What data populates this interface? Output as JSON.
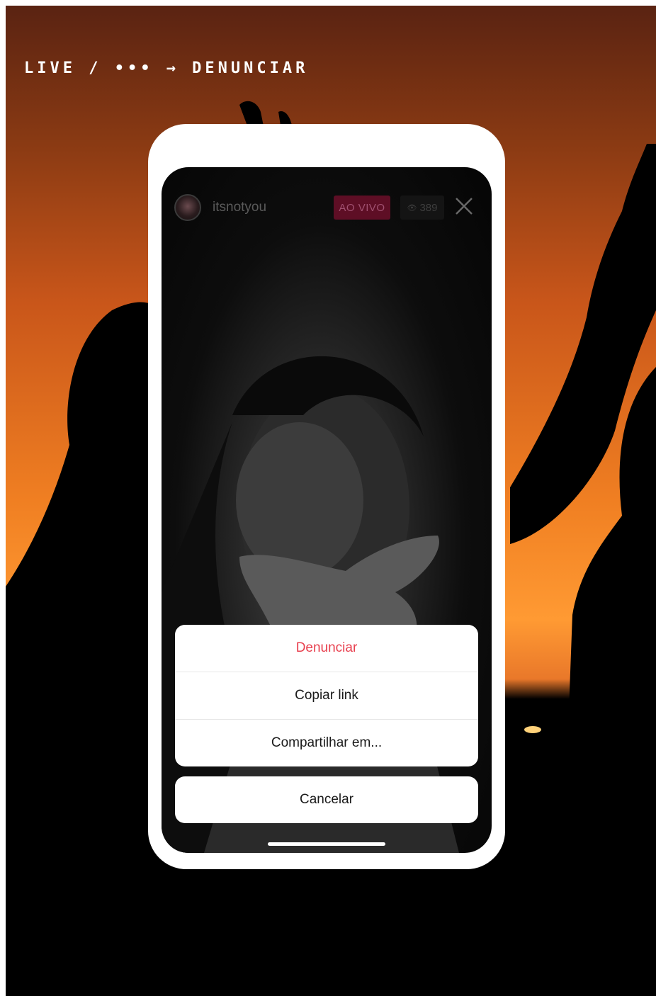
{
  "caption": "LIVE / ••• → DENUNCIAR",
  "live_screen": {
    "username": "itsnotyou",
    "live_badge": "AO VIVO",
    "viewer_count": "389",
    "viewer_icon": "eye-icon",
    "close_icon": "close-icon"
  },
  "action_sheet": {
    "items": [
      {
        "label": "Denunciar"
      },
      {
        "label": "Copiar link"
      },
      {
        "label": "Compartilhar em..."
      }
    ],
    "cancel_label": "Cancelar"
  },
  "colors": {
    "danger": "#e8404f",
    "live_badge": "#5e0e25",
    "sunset_orange": "#f07f22"
  }
}
